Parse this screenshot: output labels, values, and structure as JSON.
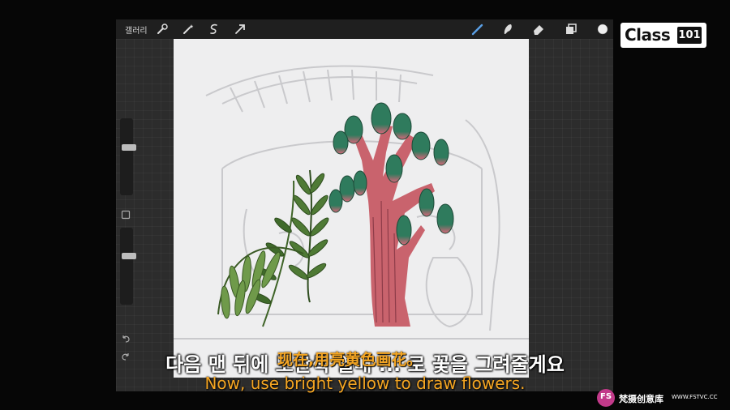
{
  "app": {
    "gallery_label": "갤러리",
    "left_tools": [
      "wrench-icon",
      "magic-wand-icon",
      "selection-icon",
      "transform-arrow-icon"
    ],
    "right_tools": [
      "brush-icon",
      "smudge-icon",
      "eraser-icon",
      "layers-icon",
      "color-swatch-icon"
    ],
    "current_color": "#f0f0f0"
  },
  "logo": {
    "text": "Class",
    "number": "101"
  },
  "subtitles": {
    "korean": "다음 맨 뒤에 노란색 열매 ... 로 꽃을 그려줄게요",
    "chinese": "现在,用亮黄色画花。",
    "english": "Now, use bright yellow to draw flowers."
  },
  "watermark": {
    "badge": "FS",
    "name": "梵摄创意库",
    "url": "WWW.FSTVC.CC"
  },
  "colors": {
    "accent": "#f5a623",
    "trunk": "#c9636d",
    "cactus": "#2e7a5c",
    "fern": "#5a8a40"
  }
}
